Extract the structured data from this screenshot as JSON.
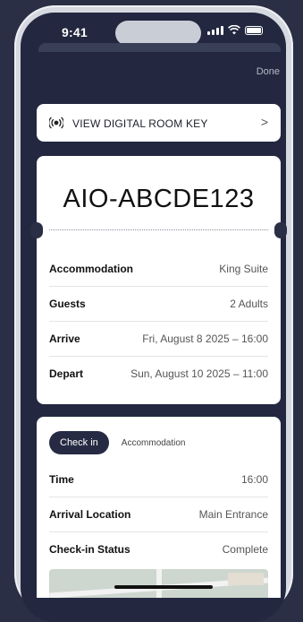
{
  "status_bar": {
    "time": "9:41"
  },
  "header": {
    "done_label": "Done"
  },
  "room_key": {
    "label": "VIEW DIGITAL ROOM KEY",
    "chevron": ">"
  },
  "booking": {
    "code": "AIO-ABCDE123",
    "rows": [
      {
        "key": "Accommodation",
        "value": "King Suite"
      },
      {
        "key": "Guests",
        "value": "2 Adults"
      },
      {
        "key": "Arrive",
        "value": "Fri, August 8 2025 – 16:00"
      },
      {
        "key": "Depart",
        "value": "Sun, August 10 2025  – 11:00"
      }
    ]
  },
  "details": {
    "tabs": [
      {
        "label": "Check in",
        "active": true
      },
      {
        "label": "Accommodation",
        "active": false
      }
    ],
    "rows": [
      {
        "key": "Time",
        "value": "16:00"
      },
      {
        "key": "Arrival Location",
        "value": "Main Entrance"
      },
      {
        "key": "Check-in Status",
        "value": "Complete"
      }
    ]
  },
  "colors": {
    "background": "#2b2f45",
    "screen": "#232840",
    "accent": "#262b43"
  }
}
